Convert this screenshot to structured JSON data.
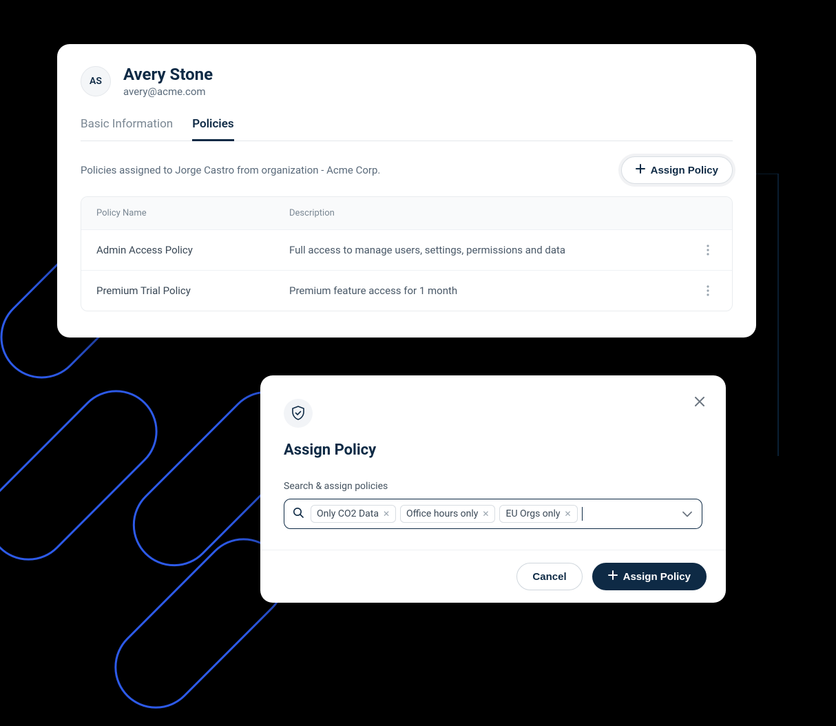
{
  "colors": {
    "accent": "#2d5ae8",
    "brand_dark": "#0e2a45"
  },
  "user": {
    "initials": "AS",
    "name": "Avery Stone",
    "email": "avery@acme.com"
  },
  "tabs": [
    {
      "label": "Basic Information",
      "active": false
    },
    {
      "label": "Policies",
      "active": true
    }
  ],
  "policies_caption": "Policies assigned to Jorge Castro from organization - Acme Corp.",
  "assign_button_label": "Assign Policy",
  "table": {
    "headers": {
      "name": "Policy Name",
      "description": "Description"
    },
    "rows": [
      {
        "name": "Admin Access Policy",
        "description": "Full access to manage users, settings, permissions and data"
      },
      {
        "name": "Premium Trial Policy",
        "description": "Premium feature access for 1 month"
      }
    ]
  },
  "modal": {
    "title": "Assign Policy",
    "field_label": "Search & assign policies",
    "chips": [
      "Only CO2 Data",
      "Office hours only",
      "EU Orgs only"
    ],
    "cancel_label": "Cancel",
    "submit_label": "Assign Policy"
  }
}
